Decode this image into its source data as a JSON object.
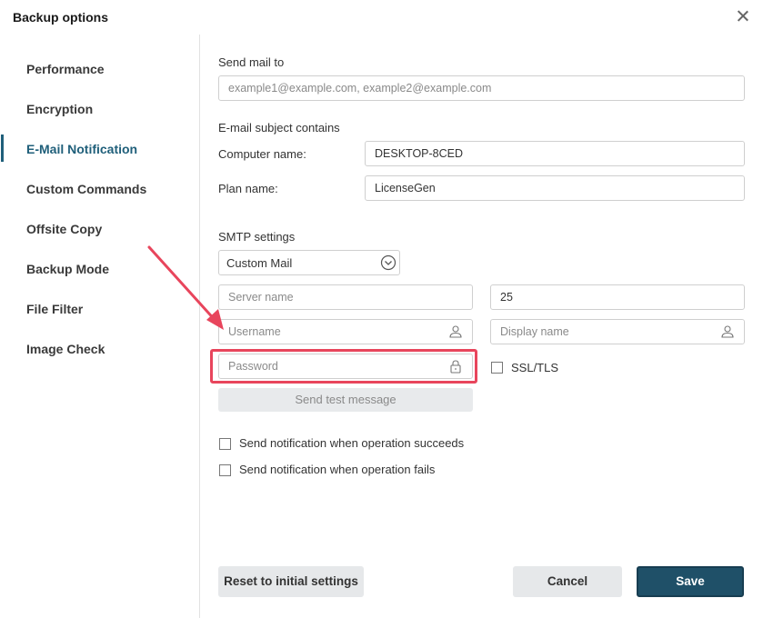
{
  "dialog": {
    "title": "Backup options"
  },
  "sidebar": {
    "items": [
      {
        "label": "Performance"
      },
      {
        "label": "Encryption"
      },
      {
        "label": "E-Mail Notification"
      },
      {
        "label": "Custom Commands"
      },
      {
        "label": "Offsite Copy"
      },
      {
        "label": "Backup Mode"
      },
      {
        "label": "File Filter"
      },
      {
        "label": "Image Check"
      }
    ],
    "active": "E-Mail Notification"
  },
  "mail": {
    "send_to_label": "Send mail to",
    "send_to_placeholder": "example1@example.com, example2@example.com",
    "subject_label": "E-mail subject contains",
    "computer_name_label": "Computer name:",
    "computer_name_value": "DESKTOP-8CED",
    "plan_name_label": "Plan name:",
    "plan_name_value": "LicenseGen"
  },
  "smtp": {
    "label": "SMTP settings",
    "provider_selected": "Custom Mail",
    "server_placeholder": "Server name",
    "port_value": "25",
    "username_placeholder": "Username",
    "display_name_placeholder": "Display name",
    "password_placeholder": "Password",
    "ssl_label": "SSL/TLS",
    "ssl_checked": false,
    "test_button": "Send test message"
  },
  "notifications": {
    "on_success_label": "Send notification when operation succeeds",
    "on_success_checked": false,
    "on_fail_label": "Send notification when operation fails",
    "on_fail_checked": false
  },
  "footer": {
    "reset_label": "Reset to initial settings",
    "cancel_label": "Cancel",
    "save_label": "Save"
  },
  "colors": {
    "accent": "#1f5f7a",
    "primary_button": "#1f5068",
    "highlight": "#e8455c"
  }
}
